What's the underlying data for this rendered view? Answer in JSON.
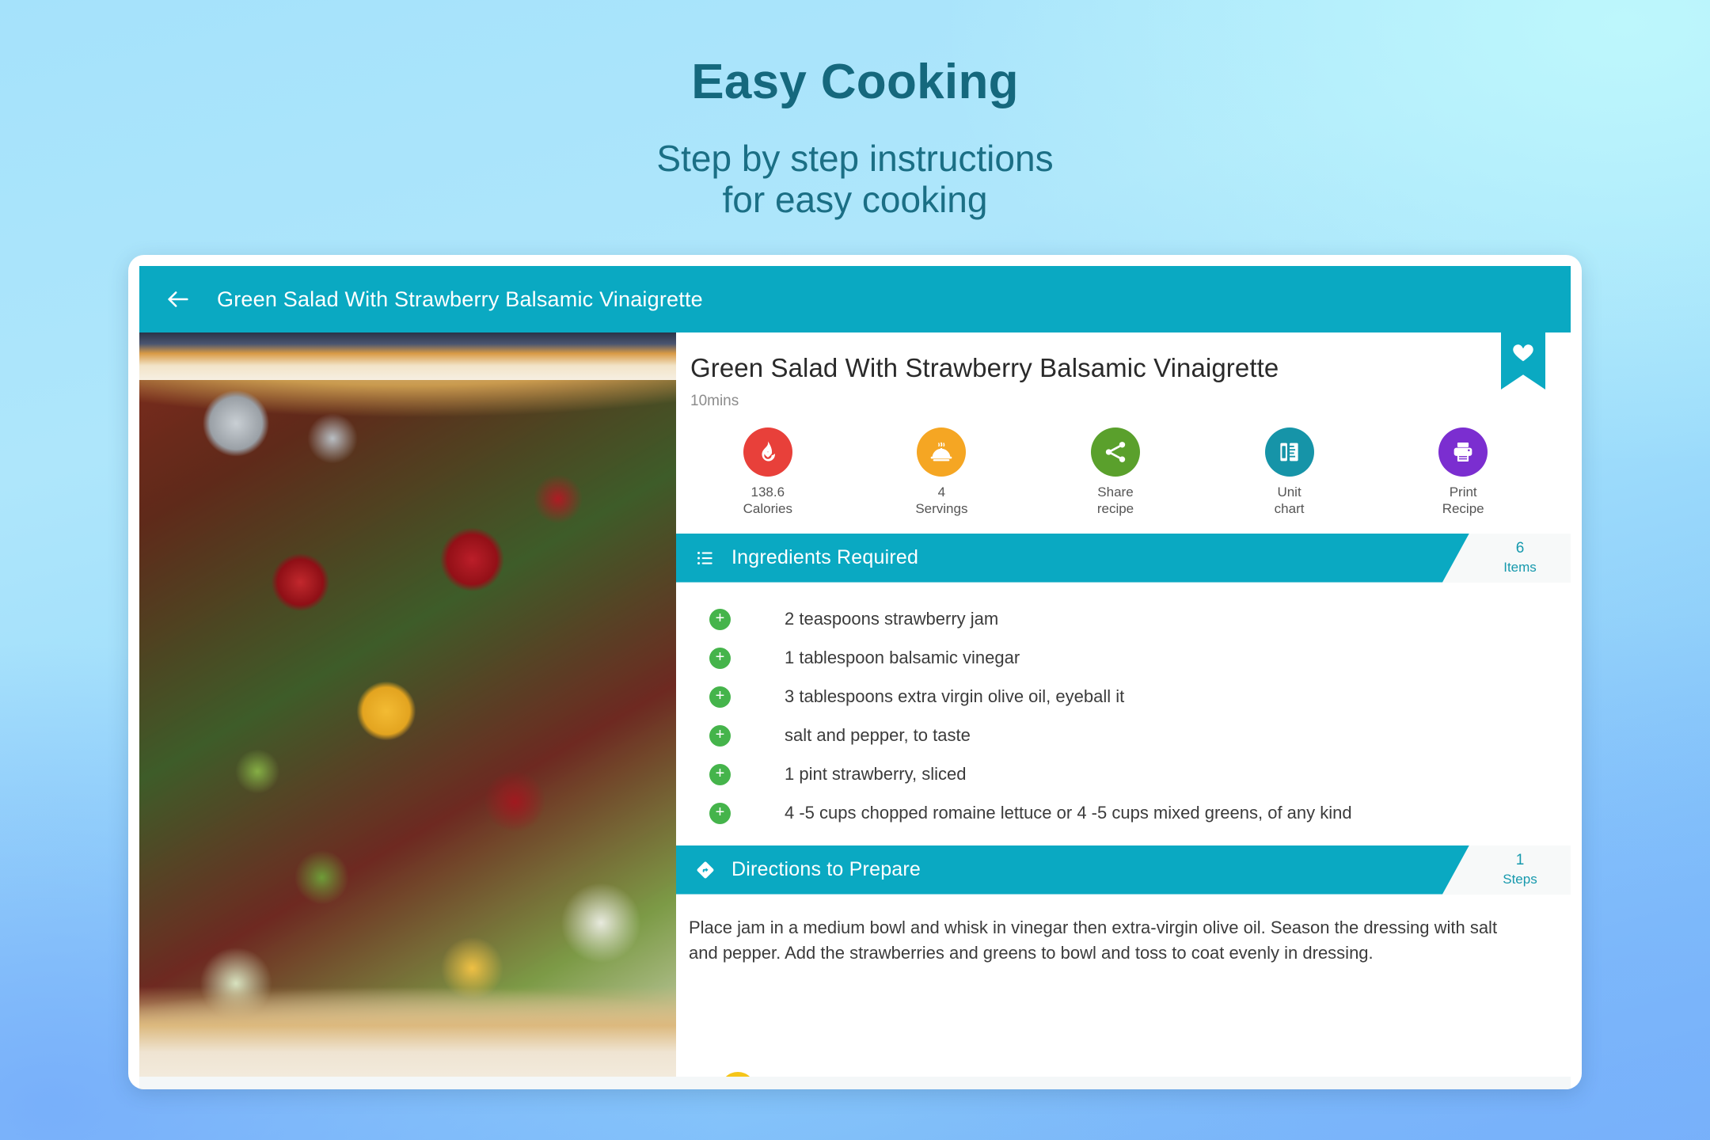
{
  "hero": {
    "title": "Easy Cooking",
    "subtitle_line1": "Step by step instructions",
    "subtitle_line2": "for easy cooking"
  },
  "appbar": {
    "back_icon": "arrow-left-icon",
    "title": "Green Salad With Strawberry Balsamic Vinaigrette",
    "background_color": "#0aa9c2"
  },
  "recipe": {
    "title": "Green Salad With Strawberry Balsamic Vinaigrette",
    "time": "10mins",
    "favorite_icon": "heart-icon"
  },
  "stats": [
    {
      "icon": "calories-flame-icon",
      "value": "138.6",
      "label": "Calories",
      "color": "#e8403a"
    },
    {
      "icon": "serving-cloche-icon",
      "value": "4",
      "label": "Servings",
      "color": "#f5a623"
    },
    {
      "icon": "share-icon",
      "value": "Share",
      "label": "recipe",
      "color": "#5aa02c"
    },
    {
      "icon": "ruler-unit-chart-icon",
      "value": "Unit",
      "label": "chart",
      "color": "#1694a8"
    },
    {
      "icon": "printer-icon",
      "value": "Print",
      "label": "Recipe",
      "color": "#7b2ed0"
    }
  ],
  "ingredients_section": {
    "icon": "list-icon",
    "title": "Ingredients Required",
    "count": "6",
    "count_label": "Items",
    "add_icon": "plus-icon",
    "items": [
      "2 teaspoons strawberry jam",
      "1 tablespoon balsamic vinegar",
      "3 tablespoons extra virgin olive oil, eyeball it",
      "salt and pepper, to taste",
      "1 pint strawberry, sliced",
      "4 -5 cups chopped romaine lettuce or 4 -5 cups mixed greens, of any kind"
    ]
  },
  "directions_section": {
    "icon": "directions-diamond-icon",
    "title": "Directions to Prepare",
    "count": "1",
    "count_label": "Steps",
    "steps": [
      "Place jam in a medium bowl and whisk in vinegar then extra-virgin olive oil. Season the dressing with salt and pepper. Add the strawberries and greens to bowl and toss to coat evenly in dressing."
    ]
  },
  "photo": {
    "alt": "green-salad-with-strawberries-photo"
  }
}
